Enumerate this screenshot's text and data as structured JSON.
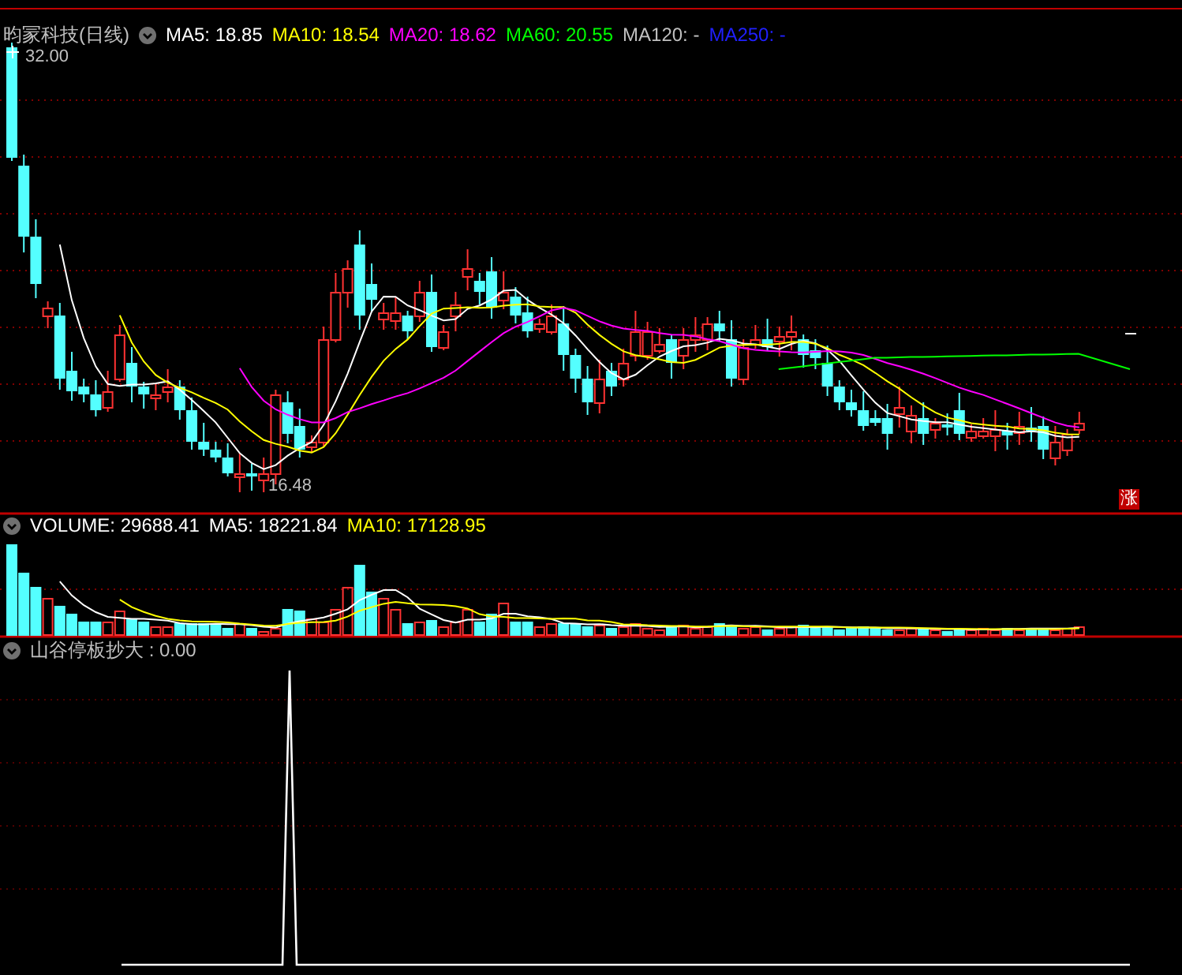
{
  "main_panel": {
    "title": "昀冡科技(日线)",
    "ma_labels": [
      {
        "text": "MA5: 18.85",
        "color": "#ffffff"
      },
      {
        "text": "MA10: 18.54",
        "color": "#ffff00"
      },
      {
        "text": "MA20: 18.62",
        "color": "#ff00ff"
      },
      {
        "text": "MA60: 20.55",
        "color": "#00ff00"
      },
      {
        "text": "MA120: -",
        "color": "#c0c0c0"
      },
      {
        "text": "MA250: -",
        "color": "#2020ff"
      }
    ],
    "high_label": "32.00",
    "low_label": "16.48",
    "badge": "涨"
  },
  "volume_panel": {
    "labels": [
      {
        "text": "VOLUME: 29688.41",
        "color": "#ffffff"
      },
      {
        "text": "MA5: 18221.84",
        "color": "#ffffff"
      },
      {
        "text": "MA10: 17128.95",
        "color": "#ffff00"
      }
    ]
  },
  "indicator_panel": {
    "labels": [
      {
        "text": "山谷停板抄大 : 0.00",
        "color": "#c0c0c0"
      }
    ]
  }
}
